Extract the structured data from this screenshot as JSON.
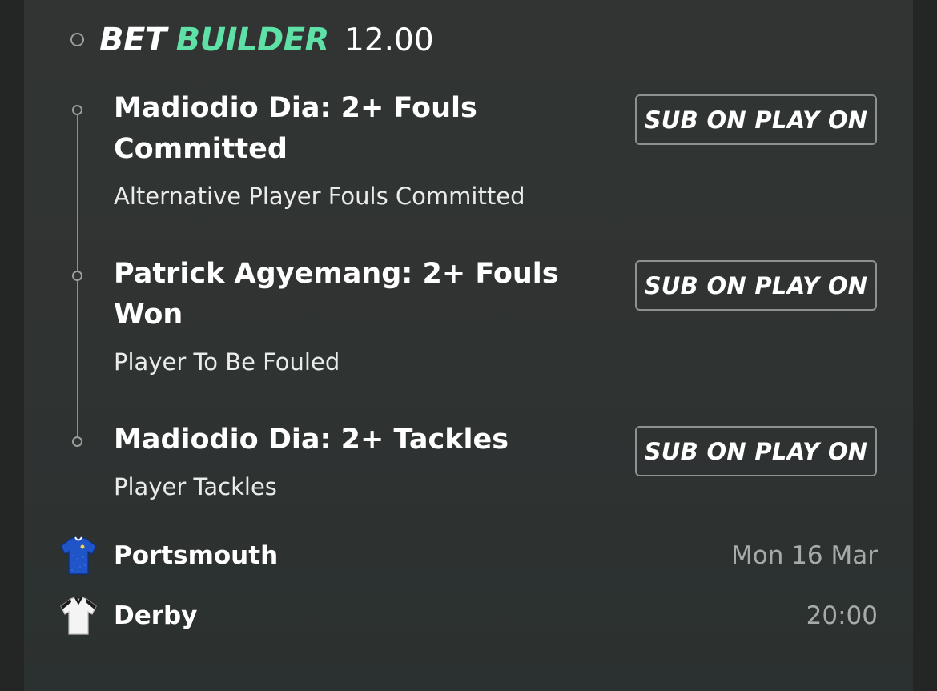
{
  "bet_builder": {
    "label_part1": "BET",
    "label_part2": "BUILDER",
    "odds": "12.00",
    "accent_color": "#5ee0a6"
  },
  "legs": [
    {
      "title_line1": "Madiodio Dia: 2+ Fouls",
      "title_line2": "Committed",
      "market": "Alternative Player Fouls Committed",
      "button_label": "SUB ON PLAY ON"
    },
    {
      "title_line1": "Patrick Agyemang: 2+ Fouls",
      "title_line2": "Won",
      "market": "Player To Be Fouled",
      "button_label": "SUB ON PLAY ON"
    },
    {
      "title_line1": "Madiodio Dia: 2+ Tackles",
      "title_line2": "",
      "market": "Player Tackles",
      "button_label": "SUB ON PLAY ON"
    }
  ],
  "match": {
    "home": {
      "name": "Portsmouth",
      "kit_icon": "blue-shirt-icon",
      "kit_color": "#1f55c8"
    },
    "away": {
      "name": "Derby",
      "kit_icon": "white-shirt-icon",
      "kit_color": "#f4f4f4"
    },
    "date": "Mon 16 Mar",
    "time": "20:00"
  }
}
